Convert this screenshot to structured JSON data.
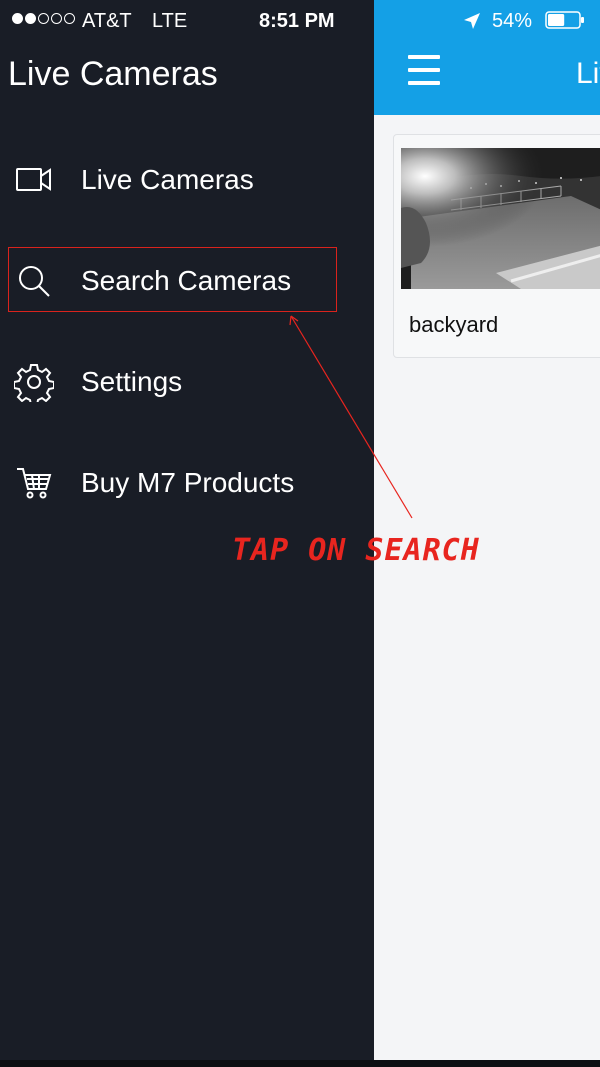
{
  "status_bar": {
    "carrier": "AT&T",
    "network": "LTE",
    "time": "8:51 PM",
    "battery_percent": "54%",
    "signal_bars_filled": 2,
    "signal_bars_total": 5,
    "battery_level": 0.54
  },
  "drawer": {
    "title": "Live Cameras",
    "items": [
      {
        "label": "Live Cameras",
        "icon": "video-camera-icon"
      },
      {
        "label": "Search Cameras",
        "icon": "search-icon"
      },
      {
        "label": "Settings",
        "icon": "gear-icon"
      },
      {
        "label": "Buy M7 Products",
        "icon": "cart-icon"
      }
    ]
  },
  "main": {
    "title": "Live Cameras",
    "cameras": [
      {
        "name": "backyard"
      }
    ]
  },
  "annotation": {
    "text": "TAP ON SEARCH"
  },
  "colors": {
    "drawer_bg": "#191d26",
    "header_bg": "#14a0e6",
    "main_bg": "#f4f5f7",
    "annotation": "#e8251f"
  }
}
